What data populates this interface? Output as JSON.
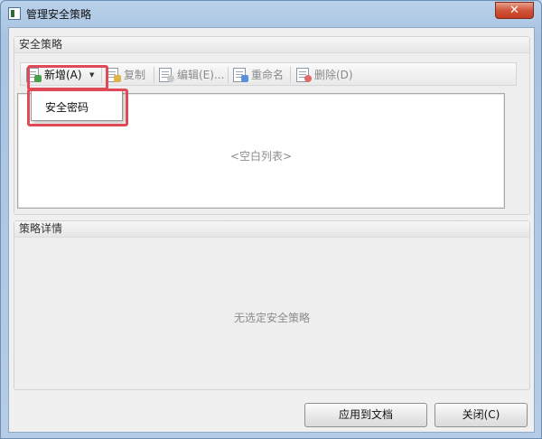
{
  "window": {
    "title": "管理安全策略",
    "close_glyph": "✕"
  },
  "policies_group": {
    "header": "安全策略",
    "empty_list_text": "<空白列表>"
  },
  "toolbar": {
    "new_label": "新增(A)",
    "copy_label": "复制",
    "edit_label": "编辑(E)...",
    "rename_label": "重命名",
    "delete_label": "删除(D)"
  },
  "new_menu": {
    "items": [
      {
        "label": "安全密码"
      }
    ]
  },
  "details_group": {
    "header": "策略详情",
    "empty_text": "无选定安全策略"
  },
  "buttons": {
    "apply_label": "应用到文档",
    "close_label": "关闭(C)"
  },
  "icons": {
    "app": "app-window-icon",
    "new": "new-policy-icon",
    "copy": "copy-policy-icon",
    "edit": "edit-policy-icon",
    "rename": "rename-policy-icon",
    "delete": "delete-policy-icon",
    "dropdown": "chevron-down-icon"
  },
  "colors": {
    "highlight": "#e04a57",
    "close_button": "#d0553a",
    "window_frame": "#b9d1ea"
  }
}
